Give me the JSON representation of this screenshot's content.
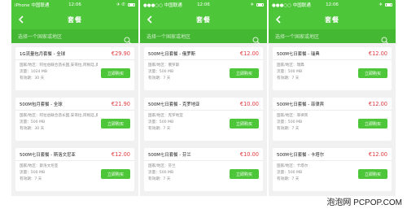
{
  "screens": [
    {
      "status": {
        "carrier": "iPhone 中国联通",
        "time": "12:06",
        "signal": "✈ ✆"
      },
      "nav": {
        "title": "套餐"
      },
      "search": {
        "placeholder": "选择一个国家或地区"
      },
      "cards": [
        {
          "name": "1G流量包月套餐 - 全球",
          "price": "€29.90",
          "lines": [
            "国家/地区：阿拉伯联合酋长国,安哥拉,阿根廷,奥地利",
            "流量：1024 MB",
            "有效期：30 天"
          ],
          "button": "立即购买"
        },
        {
          "name": "500M包月套餐 - 全球",
          "price": "€21.90",
          "lines": [
            "国家/地区：阿拉伯联合酋长国,安哥拉,阿根廷,奥地利",
            "流量：500 MB",
            "有效期：30 天"
          ],
          "button": "立即购买"
        },
        {
          "name": "500M七日套餐 - 斯洛文尼亚",
          "price": "€12.00",
          "lines": [
            "国家/地区：斯洛文尼亚",
            "流量：500 MB",
            "有效期：7 天"
          ],
          "button": "立即购买"
        }
      ]
    },
    {
      "status": {
        "carrier": "●●●○○ 中国联通",
        "time": "12:06",
        "signal": "✈"
      },
      "nav": {
        "title": "套餐"
      },
      "search": {
        "placeholder": "选择一个国家或地区"
      },
      "cards": [
        {
          "name": "500M七日套餐 - 俄罗斯",
          "price": "€12.00",
          "lines": [
            "国家/地区：俄罗斯",
            "流量：500 MB",
            "有效期：7 天"
          ],
          "button": "立即购买"
        },
        {
          "name": "500M七日套餐 - 克罗地亚",
          "price": "€10.00",
          "lines": [
            "国家/地区：克罗地亚",
            "流量：500 MB",
            "有效期：7 天"
          ],
          "button": "立即购买"
        },
        {
          "name": "500M七日套餐 - 芬兰",
          "price": "€10.00",
          "lines": [
            "国家/地区：芬兰",
            "流量：500 MB",
            "有效期：7 天"
          ],
          "button": "立即购买"
        }
      ]
    },
    {
      "status": {
        "carrier": "●●●○○ 中国联通",
        "time": "12:06",
        "signal": "✈"
      },
      "nav": {
        "title": "套餐"
      },
      "search": {
        "placeholder": "选择一个国家或地区"
      },
      "cards": [
        {
          "name": "500M七日套餐 - 瑞典",
          "price": "€12.00",
          "lines": [
            "国家/地区：瑞典",
            "流量：500 MB",
            "有效期：7 天"
          ],
          "button": "立即购买"
        },
        {
          "name": "500M七日套餐 - 菲律宾",
          "price": "€12.00",
          "lines": [
            "国家/地区：菲律宾",
            "流量：500 MB",
            "有效期：7 天"
          ],
          "button": "立即购买"
        },
        {
          "name": "500M七日套餐 - 卡塔尔",
          "price": "€12.00",
          "lines": [
            "国家/地区：卡塔尔",
            "流量：500 MB",
            "有效期：7 天"
          ],
          "button": "立即购买"
        }
      ]
    }
  ],
  "watermark": "泡泡网 PCPOP.COM",
  "colors": {
    "accent": "#4ec63a",
    "price": "#e0393e",
    "background": "#f1f1f1"
  }
}
